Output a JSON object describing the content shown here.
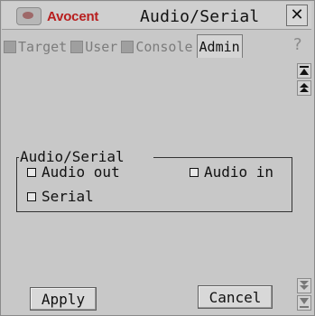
{
  "window": {
    "brand": "Avocent",
    "title": "Audio/Serial",
    "close_glyph": "✕"
  },
  "tabs": [
    {
      "label": "Target",
      "icon": "target-icon",
      "active": false
    },
    {
      "label": "User",
      "icon": "user-icon",
      "active": false
    },
    {
      "label": "Console",
      "icon": "console-icon",
      "active": false
    },
    {
      "label": "Admin",
      "icon": "",
      "active": true
    }
  ],
  "help_glyph": "?",
  "group": {
    "title": "Audio/Serial",
    "options": [
      {
        "label": "Audio out",
        "checked": false
      },
      {
        "label": "Audio in",
        "checked": false
      },
      {
        "label": "Serial",
        "checked": false
      }
    ]
  },
  "buttons": {
    "apply": "Apply",
    "cancel": "Cancel"
  },
  "colors": {
    "brand_red": "#b81e1e",
    "background": "#c8c8c8"
  }
}
